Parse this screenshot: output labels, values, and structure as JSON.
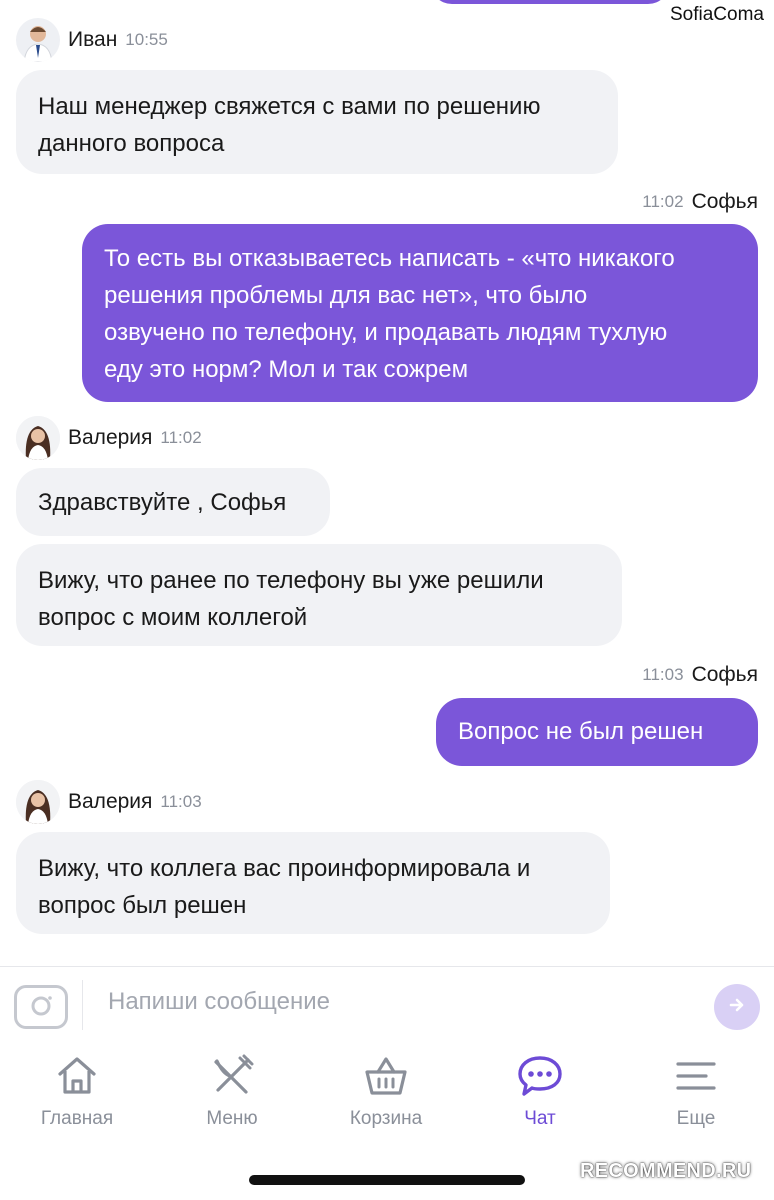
{
  "status": {
    "username": "SofiaComa"
  },
  "messages": [
    {
      "sender": "Иван",
      "time": "10:55",
      "lines": [
        "Наш менеджер свяжется с вами по решению",
        "данного вопроса"
      ]
    },
    {
      "sender": "Софья",
      "time": "11:02",
      "lines": [
        "То есть вы отказываетесь написать - «что никакого",
        "решения проблемы для вас нет», что было",
        "озвучено по телефону,  и продавать людям тухлую",
        "еду это норм? Мол и так сожрем"
      ]
    },
    {
      "sender": "Валерия",
      "time": "11:02",
      "lines": [
        "Здравствуйте  , Софья"
      ]
    },
    {
      "lines": [
        "Вижу, что ранее по телефону вы уже решили",
        "вопрос с моим коллегой"
      ]
    },
    {
      "sender": "Софья",
      "time": "11:03",
      "lines": [
        "Вопрос не был решен"
      ]
    },
    {
      "sender": "Валерия",
      "time": "11:03",
      "lines": [
        "Вижу, что коллега вас проинформировала и",
        "вопрос был решен"
      ]
    }
  ],
  "composer": {
    "placeholder": "Напиши сообщение",
    "camera_icon": "camera-icon",
    "send_icon": "arrow-right-icon"
  },
  "nav": [
    {
      "label": "Главная",
      "icon": "home-icon",
      "active": false
    },
    {
      "label": "Меню",
      "icon": "fork-knife-icon",
      "active": false
    },
    {
      "label": "Корзина",
      "icon": "basket-icon",
      "active": false
    },
    {
      "label": "Чат",
      "icon": "chat-bubble-icon",
      "active": true
    },
    {
      "label": "Еще",
      "icon": "menu-lines-icon",
      "active": false
    }
  ],
  "watermark": "RECOMMEND.RU",
  "colors": {
    "accent": "#7b56d9",
    "incoming_bubble": "#f1f2f5",
    "nav_inactive": "#8a8f99",
    "nav_active": "#6d4bd6"
  }
}
